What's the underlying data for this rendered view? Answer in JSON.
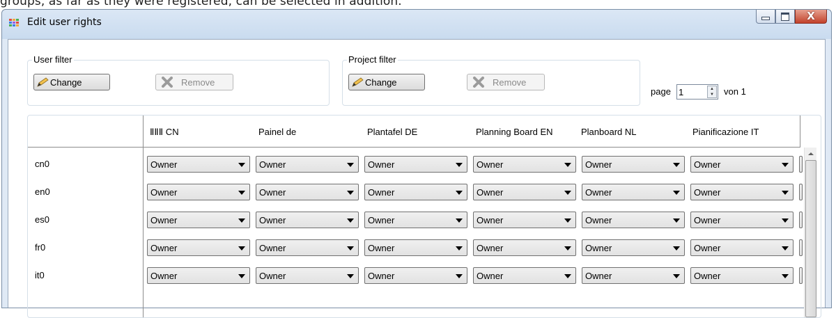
{
  "doc_text": "groups, as far as they were registered, can be selected in addition.",
  "window": {
    "title": "Edit user rights"
  },
  "user_filter": {
    "label": "User filter",
    "change_label": "Change",
    "remove_label": "Remove"
  },
  "project_filter": {
    "label": "Project filter",
    "change_label": "Change",
    "remove_label": "Remove"
  },
  "pagination": {
    "page_label": "page",
    "page_value": "1",
    "of_label": "von 1"
  },
  "columns": [
    "ⅡⅡⅡ CN",
    "Painel de",
    "Plantafel DE",
    "Planning Board EN",
    "Planboard NL",
    "Pianificazione IT"
  ],
  "rows": [
    {
      "label": "cn0",
      "values": [
        "Owner",
        "Owner",
        "Owner",
        "Owner",
        "Owner",
        "Owner"
      ]
    },
    {
      "label": "en0",
      "values": [
        "Owner",
        "Owner",
        "Owner",
        "Owner",
        "Owner",
        "Owner"
      ]
    },
    {
      "label": "es0",
      "values": [
        "Owner",
        "Owner",
        "Owner",
        "Owner",
        "Owner",
        "Owner"
      ]
    },
    {
      "label": "fr0",
      "values": [
        "Owner",
        "Owner",
        "Owner",
        "Owner",
        "Owner",
        "Owner"
      ]
    },
    {
      "label": "it0",
      "values": [
        "Owner",
        "Owner",
        "Owner",
        "Owner",
        "Owner",
        "Owner"
      ]
    }
  ],
  "icons": {
    "app": "app-grid-icon",
    "change": "pencil-icon",
    "remove": "remove-x-icon",
    "minimize": "minimize-icon",
    "maximize": "maximize-icon",
    "close": "close-icon"
  },
  "colors": {
    "close_button": "#c2422b",
    "titlebar": "#dbe7f5"
  }
}
